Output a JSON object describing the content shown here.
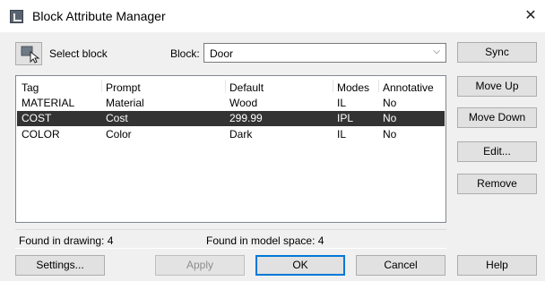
{
  "window": {
    "title": "Block Attribute Manager"
  },
  "toolbar": {
    "select_block_label": "Select block",
    "block_label": "Block:",
    "block_value": "Door"
  },
  "table": {
    "columns": [
      "Tag",
      "Prompt",
      "Default",
      "Modes",
      "Annotative"
    ],
    "rows": [
      {
        "tag": "MATERIAL",
        "prompt": "Material",
        "default": "Wood",
        "modes": "IL",
        "annotative": "No",
        "selected": false
      },
      {
        "tag": "COST",
        "prompt": "Cost",
        "default": "299.99",
        "modes": "IPL",
        "annotative": "No",
        "selected": true
      },
      {
        "tag": "COLOR",
        "prompt": "Color",
        "default": "Dark",
        "modes": "IL",
        "annotative": "No",
        "selected": false
      }
    ]
  },
  "status": {
    "found_in_drawing": "Found in drawing: 4",
    "found_in_model_space": "Found in model space: 4"
  },
  "side_buttons": {
    "sync": "Sync",
    "move_up": "Move Up",
    "move_down": "Move Down",
    "edit": "Edit...",
    "remove": "Remove"
  },
  "bottom_buttons": {
    "settings": "Settings...",
    "apply": "Apply",
    "ok": "OK",
    "cancel": "Cancel",
    "help": "Help"
  },
  "icons": {
    "app": "autocad-app-icon",
    "close": "close-icon",
    "select_block": "select-block-icon",
    "dropdown": "chevron-down-icon"
  },
  "colors": {
    "selected_row_bg": "#333333",
    "default_button_border": "#0078d7",
    "dialog_bg": "#f0f0f0"
  }
}
